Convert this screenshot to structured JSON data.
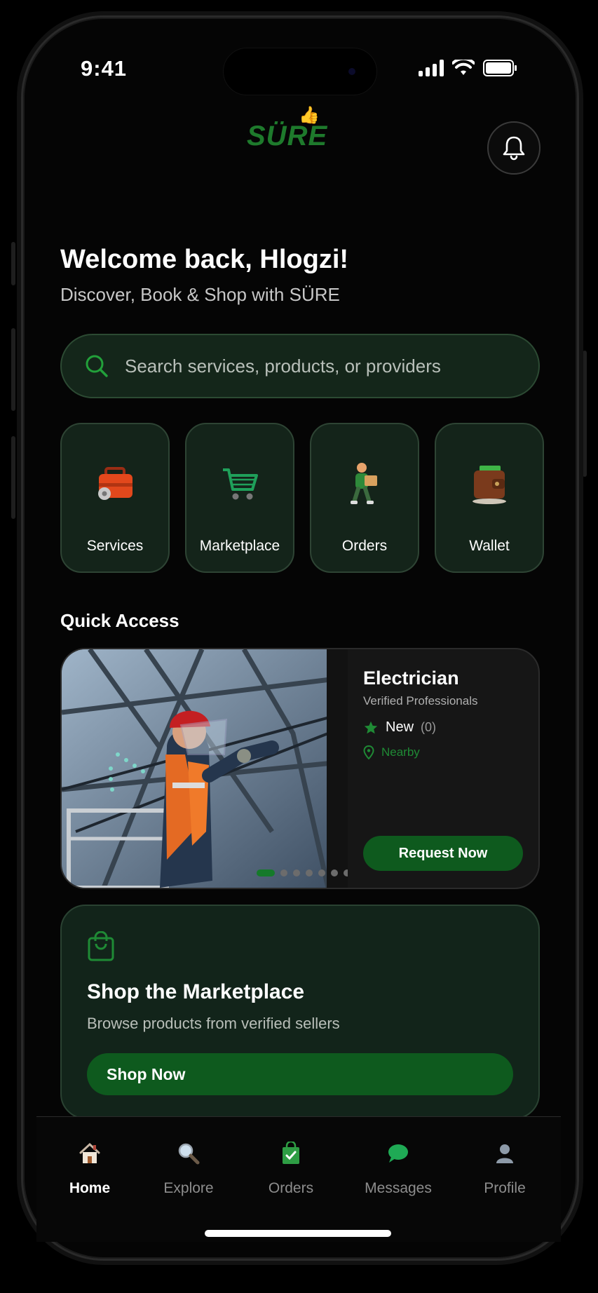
{
  "status_bar": {
    "time": "9:41"
  },
  "header": {
    "logo_text": "SÜRE"
  },
  "welcome": {
    "title": "Welcome back, Hlogzi!",
    "subtitle": "Discover, Book & Shop with SÜRE"
  },
  "search": {
    "placeholder": "Search services, products, or providers"
  },
  "categories": [
    {
      "label": "Services",
      "icon": "toolbox-icon"
    },
    {
      "label": "Marketplace",
      "icon": "shopping-cart-icon"
    },
    {
      "label": "Orders",
      "icon": "delivery-person-icon"
    },
    {
      "label": "Wallet",
      "icon": "wallet-icon"
    }
  ],
  "quick_access": {
    "section_title": "Quick Access",
    "card": {
      "title": "Electrician",
      "subtitle": "Verified Professionals",
      "rating_label": "New",
      "rating_count": "(0)",
      "location": "Nearby",
      "button": "Request Now",
      "carousel": {
        "total": 8,
        "active": 1
      }
    }
  },
  "shop": {
    "title": "Shop the Marketplace",
    "subtitle": "Browse products from verified sellers",
    "button": "Shop Now"
  },
  "tab_bar": [
    {
      "label": "Home",
      "icon": "house-icon",
      "active": true
    },
    {
      "label": "Explore",
      "icon": "magnifier-icon",
      "active": false
    },
    {
      "label": "Orders",
      "icon": "shopping-bag-icon",
      "active": false
    },
    {
      "label": "Messages",
      "icon": "chat-bubble-icon",
      "active": false
    },
    {
      "label": "Profile",
      "icon": "person-icon",
      "active": false
    }
  ],
  "colors": {
    "accent": "#1f8a35",
    "button": "#0e5a1e",
    "card": "#14241a",
    "background": "#050505"
  }
}
